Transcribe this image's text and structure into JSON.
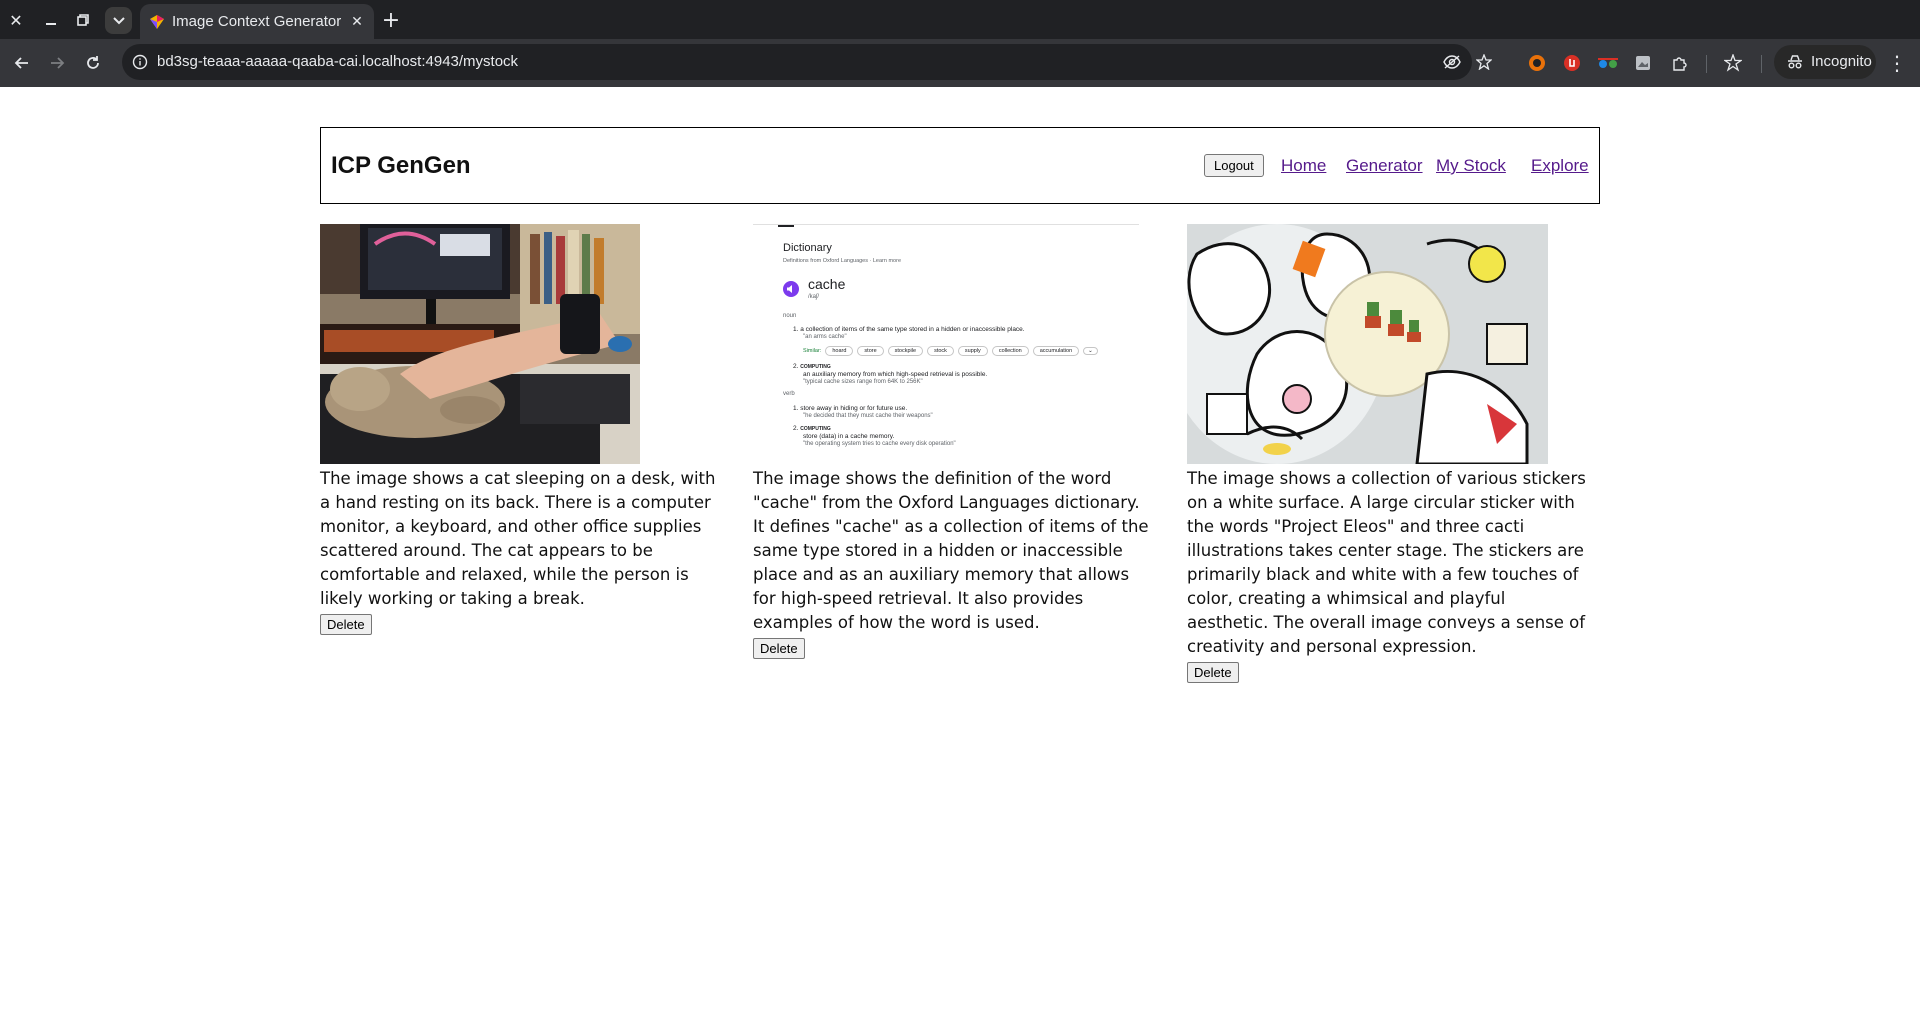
{
  "browser": {
    "tab_title": "Image Context Generator",
    "url": "bd3sg-teaaa-aaaaa-qaaba-cai.localhost:4943/mystock",
    "profile_label": "Incognito"
  },
  "app": {
    "title": "ICP GenGen",
    "logout_label": "Logout",
    "nav": [
      {
        "label": "Home"
      },
      {
        "label": "Generator"
      },
      {
        "label": "My Stock"
      },
      {
        "label": "Explore"
      }
    ]
  },
  "cards": [
    {
      "description": "The image shows a cat sleeping on a desk, with a hand resting on its back. There is a computer monitor, a keyboard, and other office supplies scattered around. The cat appears to be comfortable and relaxed, while the person is likely working or taking a break.",
      "delete_label": "Delete"
    },
    {
      "description": "The image shows the definition of the word \"cache\" from the Oxford Languages dictionary. It defines \"cache\" as a collection of items of the same type stored in a hidden or inaccessible place and as an auxiliary memory that allows for high-speed retrieval. It also provides examples of how the word is used.",
      "delete_label": "Delete",
      "screenshot": {
        "heading": "Dictionary",
        "source": "Definitions from Oxford Languages · Learn more",
        "word": "cache",
        "phonetic": "/kaʃ/",
        "pos_noun": "noun",
        "def1": "a collection of items of the same type stored in a hidden or inaccessible place.",
        "ex1": "\"an arms cache\"",
        "similar_label": "Similar:",
        "similar": [
          "hoard",
          "store",
          "stockpile",
          "stock",
          "supply",
          "collection",
          "accumulation"
        ],
        "computing": "COMPUTING",
        "def2": "an auxiliary memory from which high-speed retrieval is possible.",
        "ex2": "\"typical cache sizes range from 64K to 256K\"",
        "pos_verb": "verb",
        "def3": "store away in hiding or for future use.",
        "ex3": "\"he decided that they must cache their weapons\"",
        "def4": "store (data) in a cache memory.",
        "ex4": "\"the operating system tries to cache every disk operation\""
      }
    },
    {
      "description": "The image shows a collection of various stickers on a white surface. A large circular sticker with the words \"Project Eleos\" and three cacti illustrations takes center stage. The stickers are primarily black and white with a few touches of color, creating a whimsical and playful aesthetic. The overall image conveys a sense of creativity and personal expression.",
      "delete_label": "Delete"
    }
  ],
  "colors": {
    "link": "#551a8b",
    "chrome_dark": "#202124",
    "chrome_toolbar": "#35363a"
  }
}
